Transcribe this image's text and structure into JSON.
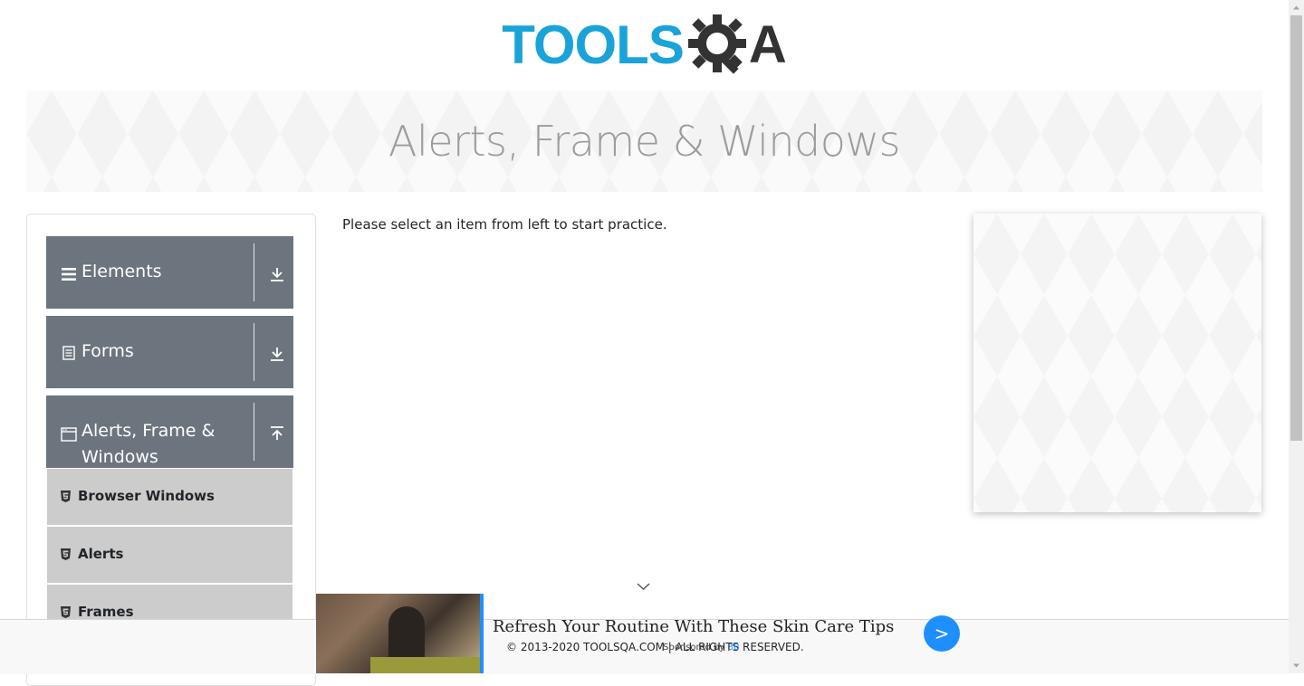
{
  "logo": {
    "text": "TOOLS",
    "qa_suffix": "A"
  },
  "banner": {
    "title": "Alerts, Frame & Windows"
  },
  "sidebar": {
    "groups": [
      {
        "label": "Elements",
        "icon": "hamburger-icon",
        "state": "collapsed"
      },
      {
        "label": "Forms",
        "icon": "document-icon",
        "state": "collapsed"
      },
      {
        "label_line1": "Alerts, Frame &",
        "label_line2": "Windows",
        "icon": "window-icon",
        "state": "expanded"
      }
    ],
    "items": [
      {
        "label": "Browser Windows",
        "icon": "html5-icon"
      },
      {
        "label": "Alerts",
        "icon": "html5-icon"
      },
      {
        "label": "Frames",
        "icon": "html5-icon"
      }
    ]
  },
  "main": {
    "instruction": "Please select an item from left to start practice."
  },
  "footer": {
    "copyright": "© 2013-2020 TOOLSQA.COM | ALL RIGHTS RESERVED."
  },
  "ad": {
    "title": "Refresh Your Routine With These Skin Care Tips",
    "sponsored_prefix": "Sponsored by",
    "sponsor": "3B",
    "go_label": ">",
    "accent_color": "#1f8fff"
  },
  "colors": {
    "brand_blue": "#1aa3d9",
    "sidebar_group": "#6c757d",
    "sidebar_item": "#cccccc"
  }
}
